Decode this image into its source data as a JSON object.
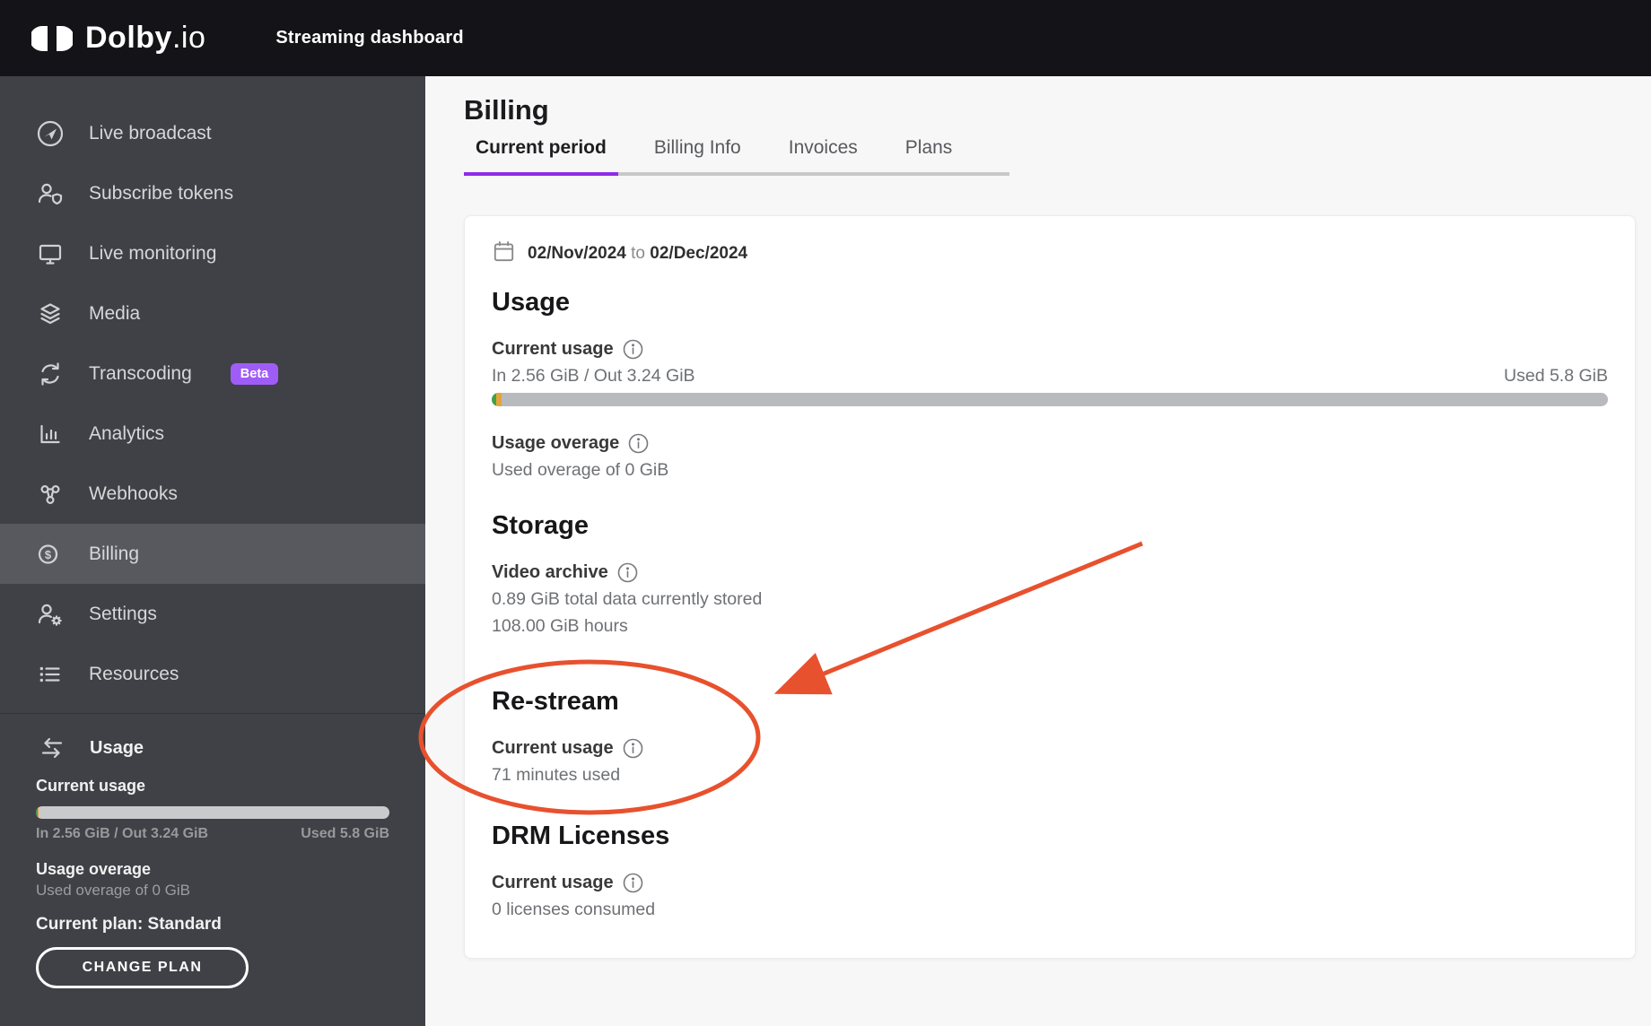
{
  "header": {
    "brand_bold": "Dolby",
    "brand_suffix": ".io",
    "app_title": "Streaming dashboard"
  },
  "sidebar": {
    "items": [
      {
        "id": "live-broadcast",
        "label": "Live broadcast",
        "icon": "broadcast-icon"
      },
      {
        "id": "subscribe-tokens",
        "label": "Subscribe tokens",
        "icon": "user-shield-icon"
      },
      {
        "id": "live-monitoring",
        "label": "Live monitoring",
        "icon": "monitor-icon"
      },
      {
        "id": "media",
        "label": "Media",
        "icon": "layers-icon"
      },
      {
        "id": "transcoding",
        "label": "Transcoding",
        "icon": "transcode-icon",
        "badge": "Beta"
      },
      {
        "id": "analytics",
        "label": "Analytics",
        "icon": "bar-chart-icon"
      },
      {
        "id": "webhooks",
        "label": "Webhooks",
        "icon": "webhook-icon"
      },
      {
        "id": "billing",
        "label": "Billing",
        "icon": "billing-icon",
        "selected": true
      },
      {
        "id": "settings",
        "label": "Settings",
        "icon": "user-gear-icon"
      },
      {
        "id": "resources",
        "label": "Resources",
        "icon": "list-icon"
      }
    ],
    "usage_panel": {
      "title": "Usage",
      "current_usage_label": "Current usage",
      "in_out": "In 2.56 GiB / Out 3.24 GiB",
      "used": "Used 5.8 GiB",
      "overage_label": "Usage overage",
      "overage_value": "Used overage of 0 GiB",
      "plan_label": "Current plan: Standard",
      "change_plan_button": "CHANGE PLAN"
    }
  },
  "main": {
    "page_title": "Billing",
    "tabs": [
      {
        "label": "Current period",
        "active": true
      },
      {
        "label": "Billing Info",
        "active": false
      },
      {
        "label": "Invoices",
        "active": false
      },
      {
        "label": "Plans",
        "active": false
      }
    ],
    "period": {
      "start": "02/Nov/2024",
      "separator": "to",
      "end": "02/Dec/2024"
    },
    "usage": {
      "heading": "Usage",
      "current_usage_label": "Current usage",
      "in_out": "In 2.56 GiB / Out 3.24 GiB",
      "used": "Used 5.8 GiB",
      "overage_label": "Usage overage",
      "overage_value": "Used overage of 0 GiB"
    },
    "storage": {
      "heading": "Storage",
      "archive_label": "Video archive",
      "stored_line": "0.89 GiB total data currently stored",
      "hours_line": "108.00 GiB hours"
    },
    "restream": {
      "heading": "Re-stream",
      "usage_label": "Current usage",
      "value": "71 minutes used"
    },
    "drm": {
      "heading": "DRM Licenses",
      "usage_label": "Current usage",
      "value": "0 licenses consumed"
    }
  },
  "usage_bar": {
    "segments": [
      {
        "name": "in",
        "color": "#43a047",
        "pct": 0.4
      },
      {
        "name": "out",
        "color": "#e5a33c",
        "pct": 0.45
      }
    ]
  },
  "colors": {
    "header_bg": "#131318",
    "sidebar_bg": "#3f4146",
    "sidebar_selected_bg": "#57595e",
    "accent_purple": "#8f2be8",
    "badge_purple": "#a05cf7",
    "annotation_red": "#e8512e",
    "bar_track_light": "#c9cacc",
    "bar_track_main": "#b9babd"
  }
}
